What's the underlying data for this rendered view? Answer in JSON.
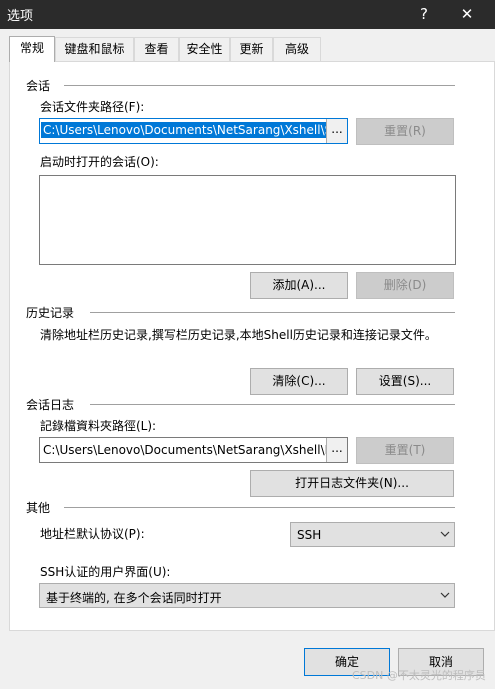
{
  "window": {
    "title": "选项",
    "help": "?",
    "close": "✕"
  },
  "tabs": [
    {
      "label": "常规"
    },
    {
      "label": "键盘和鼠标"
    },
    {
      "label": "查看"
    },
    {
      "label": "安全性"
    },
    {
      "label": "更新"
    },
    {
      "label": "高级"
    }
  ],
  "session": {
    "group_title": "会话",
    "folder_label": "会话文件夹路径(F):",
    "folder_value": "C:\\Users\\Lenovo\\Documents\\NetSarang\\Xshell\\Se",
    "browse": "...",
    "reset": "重置(R)",
    "startup_label": "启动时打开的会话(O):",
    "add": "添加(A)...",
    "delete": "删除(D)"
  },
  "history": {
    "group_title": "历史记录",
    "desc": "清除地址栏历史记录,撰写栏历史记录,本地Shell历史记录和连接记录文件。",
    "clear": "清除(C)...",
    "settings": "设置(S)..."
  },
  "session_log": {
    "group_title": "会话日志",
    "folder_label": "記錄檔資料夾路徑(L):",
    "folder_value": "C:\\Users\\Lenovo\\Documents\\NetSarang\\Xshell\\Lo",
    "browse": "...",
    "reset": "重置(T)",
    "open_folder": "打开日志文件夹(N)..."
  },
  "other": {
    "group_title": "其他",
    "protocol_label": "地址栏默认协议(P):",
    "protocol_value": "SSH",
    "ssh_ui_label": "SSH认证的用户界面(U):",
    "ssh_ui_value": "基于终端的, 在多个会话同时打开"
  },
  "footer": {
    "ok": "确定",
    "cancel": "取消",
    "watermark": "CSDN @不太灵光的程序员"
  }
}
